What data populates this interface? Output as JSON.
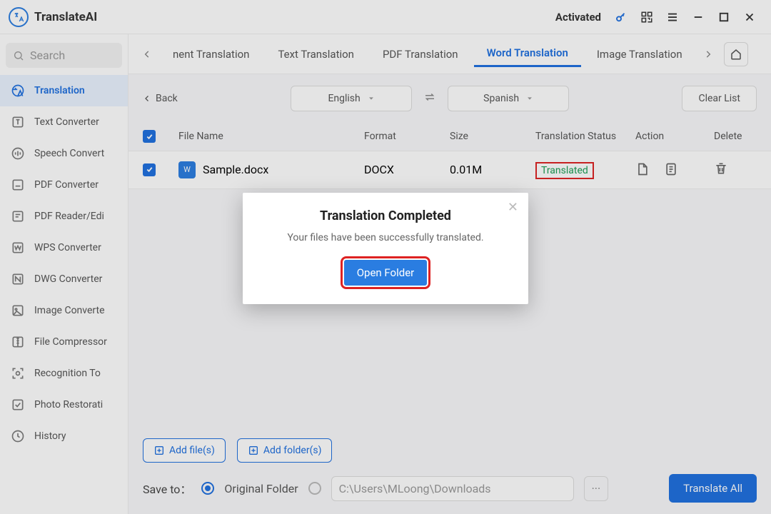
{
  "app": {
    "name": "TranslateAI",
    "activated": "Activated",
    "searchPlaceholder": "Search"
  },
  "nav": {
    "items": [
      {
        "label": "Translation"
      },
      {
        "label": "Text Converter"
      },
      {
        "label": "Speech Convert"
      },
      {
        "label": "PDF Converter"
      },
      {
        "label": "PDF Reader/Edi"
      },
      {
        "label": "WPS Converter"
      },
      {
        "label": "DWG Converter"
      },
      {
        "label": "Image Converte"
      },
      {
        "label": "File Compressor"
      },
      {
        "label": "Recognition To"
      },
      {
        "label": "Photo Restorati"
      },
      {
        "label": "History"
      }
    ]
  },
  "tabs": {
    "items": [
      {
        "label": "nent Translation"
      },
      {
        "label": "Text Translation"
      },
      {
        "label": "PDF Translation"
      },
      {
        "label": "Word Translation"
      },
      {
        "label": "Image Translation"
      }
    ]
  },
  "toolbar": {
    "back": "Back",
    "from": "English",
    "to": "Spanish",
    "clear": "Clear List"
  },
  "columns": {
    "name": "File Name",
    "format": "Format",
    "size": "Size",
    "status": "Translation Status",
    "action": "Action",
    "del": "Delete"
  },
  "rows": [
    {
      "name": "Sample.docx",
      "format": "DOCX",
      "size": "0.01M",
      "status": "Translated"
    }
  ],
  "buttons": {
    "addFiles": "Add file(s)",
    "addFolders": "Add folder(s)",
    "translateAll": "Translate All"
  },
  "save": {
    "label": "Save to：",
    "original": "Original Folder",
    "path": "C:\\Users\\MLoong\\Downloads"
  },
  "modal": {
    "title": "Translation Completed",
    "message": "Your files have been successfully translated.",
    "button": "Open Folder"
  }
}
